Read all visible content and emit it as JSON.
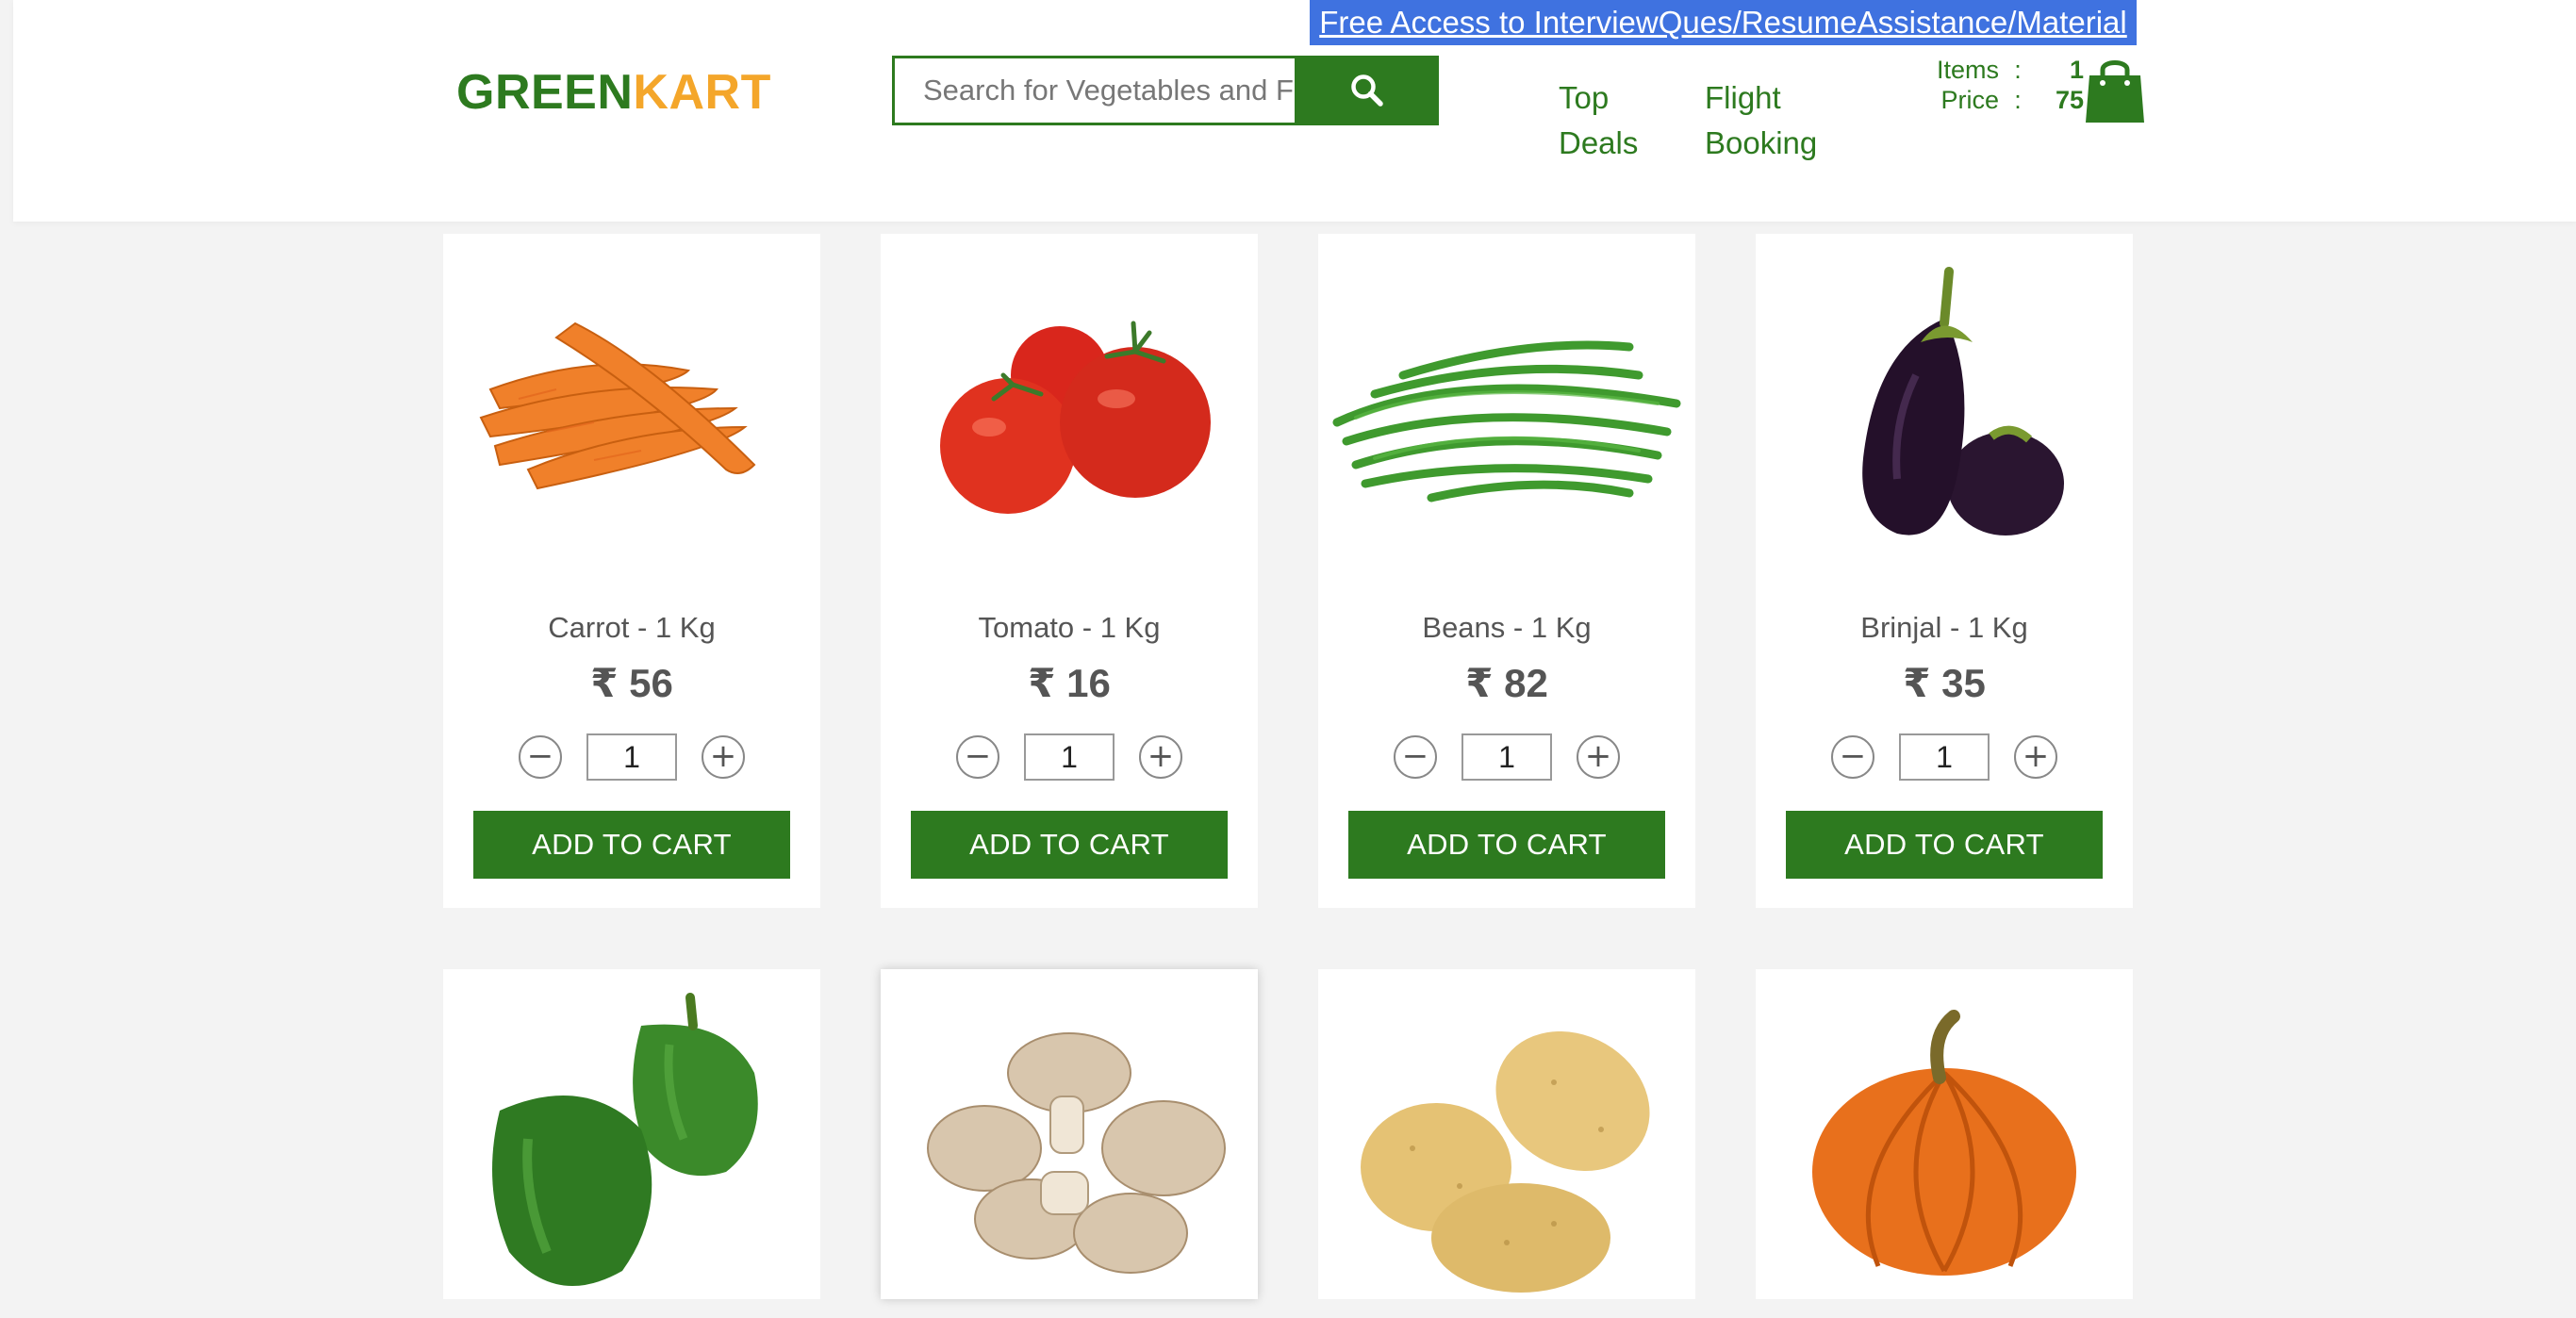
{
  "promo": {
    "text": "Free Access to InterviewQues/ResumeAssistance/Material"
  },
  "logo": {
    "green": "GREEN",
    "kart": "KART"
  },
  "search": {
    "placeholder": "Search for Vegetables and Fruits",
    "icon": "search-icon"
  },
  "nav": [
    {
      "line1": "Top",
      "line2": "Deals"
    },
    {
      "line1": "Flight",
      "line2": "Booking"
    }
  ],
  "cart": {
    "items_label": "Items",
    "items_value": "1",
    "price_label": "Price",
    "price_value": "75",
    "separator": ":",
    "icon": "shopping-bag-icon"
  },
  "products": [
    {
      "name": "Carrot - 1 Kg",
      "price": "₹ 56",
      "qty": "1",
      "button": "ADD TO CART",
      "icon": "carrot-image"
    },
    {
      "name": "Tomato - 1 Kg",
      "price": "₹ 16",
      "qty": "1",
      "button": "ADD TO CART",
      "icon": "tomato-image"
    },
    {
      "name": "Beans - 1 Kg",
      "price": "₹ 82",
      "qty": "1",
      "button": "ADD TO CART",
      "icon": "beans-image"
    },
    {
      "name": "Brinjal - 1 Kg",
      "price": "₹ 35",
      "qty": "1",
      "button": "ADD TO CART",
      "icon": "brinjal-image"
    },
    {
      "icon": "capsicum-image"
    },
    {
      "icon": "mushroom-image"
    },
    {
      "icon": "potato-image"
    },
    {
      "icon": "pumpkin-image"
    }
  ],
  "stepper": {
    "minus": "−",
    "plus": "+"
  },
  "colors": {
    "brand_green": "#2d7a1f",
    "brand_orange": "#f4a62a",
    "promo_blue": "#3f72e0",
    "background": "#f3f3f3"
  }
}
